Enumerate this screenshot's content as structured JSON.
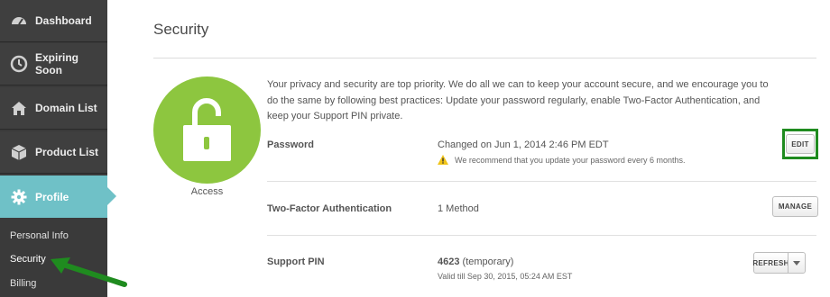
{
  "sidebar": {
    "items": [
      {
        "label": "Dashboard",
        "icon": "speedometer-icon"
      },
      {
        "label": "Expiring Soon",
        "icon": "clock-icon"
      },
      {
        "label": "Domain List",
        "icon": "home-icon"
      },
      {
        "label": "Product List",
        "icon": "box-icon"
      },
      {
        "label": "Profile",
        "icon": "gear-icon",
        "active": true
      }
    ],
    "subitems": [
      {
        "label": "Personal Info"
      },
      {
        "label": "Security",
        "current": true
      },
      {
        "label": "Billing"
      }
    ]
  },
  "main": {
    "title": "Security",
    "access_label": "Access",
    "intro": "Your privacy and security are top priority. We do all we can to keep your account secure, and we encourage you to do the same by following best practices: Update your password regularly, enable Two-Factor Authentication, and keep your Support PIN private.",
    "password": {
      "label": "Password",
      "value": "Changed on Jun 1, 2014 2:46 PM EDT",
      "warning": "We recommend that you update your password every 6 months.",
      "button": "EDIT"
    },
    "two_factor": {
      "label": "Two-Factor Authentication",
      "value": "1 Method",
      "button": "MANAGE"
    },
    "support_pin": {
      "label": "Support PIN",
      "pin": "4623",
      "pin_note": "(temporary)",
      "valid": "Valid till Sep 30, 2015, 05:24 AM EST",
      "button": "REFRESH"
    }
  },
  "colors": {
    "accent": "#6fc1c7",
    "access_green": "#8dc63f",
    "highlight_green": "#1f8b1f",
    "warning_yellow": "#f0c419"
  }
}
